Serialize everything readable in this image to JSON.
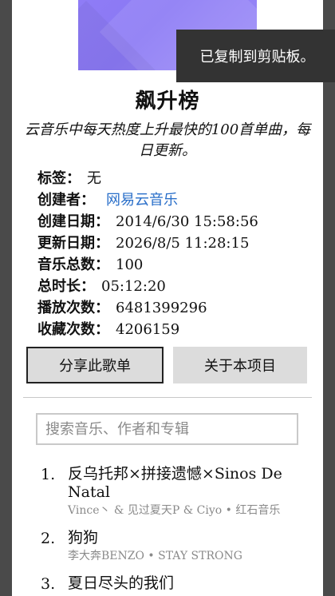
{
  "playlist": {
    "title": "飙升榜",
    "description": "云音乐中每天热度上升最快的100首单曲，每日更新。"
  },
  "meta": {
    "tags_label": "标签：",
    "tags_value": "无",
    "creator_label": "创建者：",
    "creator_value": "网易云音乐",
    "created_label": "创建日期：",
    "created_value": "2014/6/30 15:58:56",
    "updated_label": "更新日期：",
    "updated_value": "2026/8/5 11:28:15",
    "count_label": "音乐总数：",
    "count_value": "100",
    "duration_label": "总时长：",
    "duration_value": "05:12:20",
    "plays_label": "播放次数：",
    "plays_value": "6481399296",
    "fav_label": "收藏次数：",
    "fav_value": "4206159"
  },
  "actions": {
    "share_label": "分享此歌单",
    "about_label": "关于本项目"
  },
  "search": {
    "placeholder": "搜索音乐、作者和专辑",
    "value": ""
  },
  "tracks": [
    {
      "num": "1.",
      "title": "反乌托邦×拼接遗憾×Sinos De Natal",
      "sub": "Vince丶 & 见过夏天P & Ciyo • 红石音乐"
    },
    {
      "num": "2.",
      "title": "狗狗",
      "sub": "李大奔BENZO • STAY STRONG"
    },
    {
      "num": "3.",
      "title": "夏日尽头的我们",
      "sub": ""
    }
  ],
  "toast": {
    "message": "已复制到剪贴板。"
  },
  "colors": {
    "link": "#2a6fc9",
    "toast_bg": "#333333",
    "button_bg": "#dcdcdc",
    "backdrop": "#4a4a4a"
  }
}
